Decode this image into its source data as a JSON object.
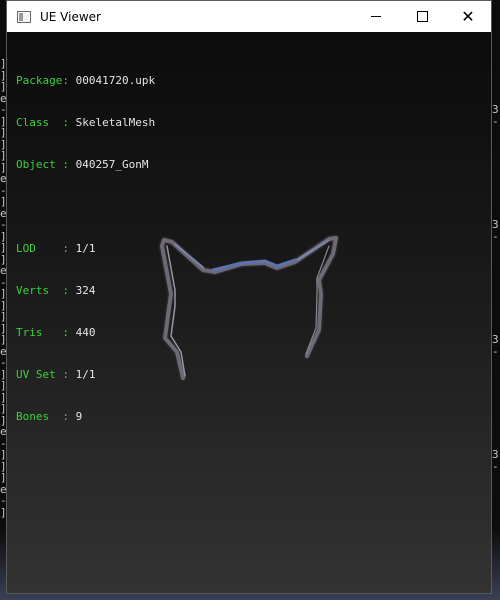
{
  "window": {
    "title": "UE Viewer",
    "minimize_label": "",
    "maximize_label": "",
    "close_label": "✕"
  },
  "info": {
    "package": {
      "label": "Package: ",
      "value": "00041720.upk"
    },
    "class": {
      "label": "Class  : ",
      "value": "SkeletalMesh"
    },
    "object": {
      "label": "Object : ",
      "value": "040257_GonM"
    },
    "lod": {
      "label": "LOD    : ",
      "value": "1/1"
    },
    "verts": {
      "label": "Verts  : ",
      "value": "324"
    },
    "tris": {
      "label": "Tris   : ",
      "value": "440"
    },
    "uvset": {
      "label": "UV Set : ",
      "value": "1/1"
    },
    "bones": {
      "label": "Bones  : ",
      "value": "9"
    }
  },
  "colors": {
    "label_green": "#3bd23b",
    "value_white": "#e6e6e6",
    "viewport_top": "#0b0b0b",
    "viewport_bottom": "#333333"
  },
  "background_console": {
    "left_edge": "]\n]\n]\ne\n-\n]\n]\n]\n]\n]\ne\n-\n]\ne\n-\n]\n]\n]\ne\n-\n]\n]\n]\n]\n]\ne\n-\n]\n]\n]\n]\n]\ne\n-\n]\n]\n]\ne\n-\n]",
    "right_edge": "\n\n\n\n3\n-\n\n\n\n\n\n\n\n\n3\n-\n\n\n\n\n\n\n\n\n3\n-\n\n\n\n\n\n\n\n\n3\n-"
  }
}
